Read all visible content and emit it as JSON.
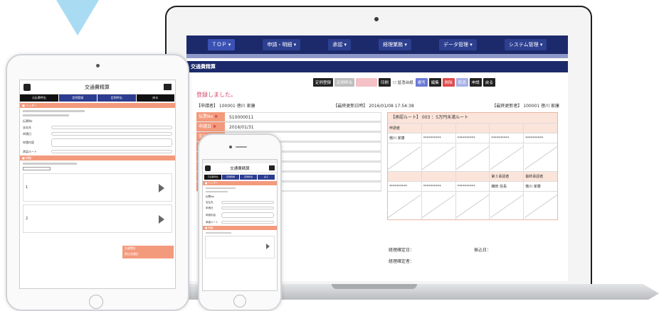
{
  "laptop": {
    "nav": [
      "ＴＯＰ ▾",
      "申請・明細 ▾",
      "承認 ▾",
      "経理業務 ▾",
      "データ管理 ▾",
      "システム管理 ▾"
    ],
    "page_title": "交通費精算",
    "message": "登録しました。",
    "toolbar": {
      "b1": "定例登録",
      "b2": "定例呼出",
      "b3": "",
      "b4": "印刷",
      "chk": "☐ 証憑台紙",
      "b5": "複写",
      "b6": "編集",
      "b7": "削除",
      "b8": "取消",
      "b9": "申請",
      "b10": "戻る"
    },
    "meta": {
      "applicant": "【申請者】 100001 徳川 家康",
      "updated": "【最終更新日時】 2016/01/08 17:54:38",
      "updater": "【最終更新者】 100001 徳川 家康"
    },
    "form": [
      {
        "label": "伝票No",
        "value": "S10000011"
      },
      {
        "label": "申請日",
        "value": "2016/01/31"
      },
      {
        "label": "支払先",
        "value": "100001 徳川 家康"
      },
      {
        "label": "",
        "value": ""
      },
      {
        "label": "",
        "value": "…ェクト"
      },
      {
        "label": "",
        "value": ""
      },
      {
        "label": "",
        "value": ""
      },
      {
        "label": "",
        "value": ""
      }
    ],
    "approval": {
      "header": "【承認ルート】 003 ：5万円未満ルート",
      "col_header": "申請者",
      "row1": [
        "徳川 家康",
        "**********",
        "**********",
        "**********",
        "**********"
      ],
      "row2_head": [
        "",
        "",
        "",
        "第３承認者",
        "最終承認者"
      ],
      "row3": [
        "**********",
        "**********",
        "**********",
        "織田 信長",
        "徳川 家康"
      ]
    },
    "footer": {
      "l1": "経理確定日：",
      "r1": "振込日：",
      "l2": "経理確定者："
    }
  },
  "tablet": {
    "title": "交通費精算",
    "tabs": [
      "元伝票呼出",
      "定例登録",
      "定例呼出",
      "戻る"
    ],
    "section1": "■ ヘッダー",
    "fields": [
      "伝票No",
      "支払先",
      "申請日",
      "申請内容"
    ],
    "route": "承認ルート",
    "section2": "■ 明細",
    "card1": "1",
    "card2": "2",
    "total1": "交通費計",
    "total2": "税込金額計"
  },
  "phone": {
    "title": "交通費精算",
    "tabs": [
      "元伝票呼出",
      "定例登録",
      "定例呼出",
      "戻る"
    ],
    "section1": "■ ヘッダー",
    "fields": [
      "伝票No",
      "支払先",
      "申請日",
      "申請内容",
      "承認ルート"
    ],
    "section2": "■ 明細"
  }
}
